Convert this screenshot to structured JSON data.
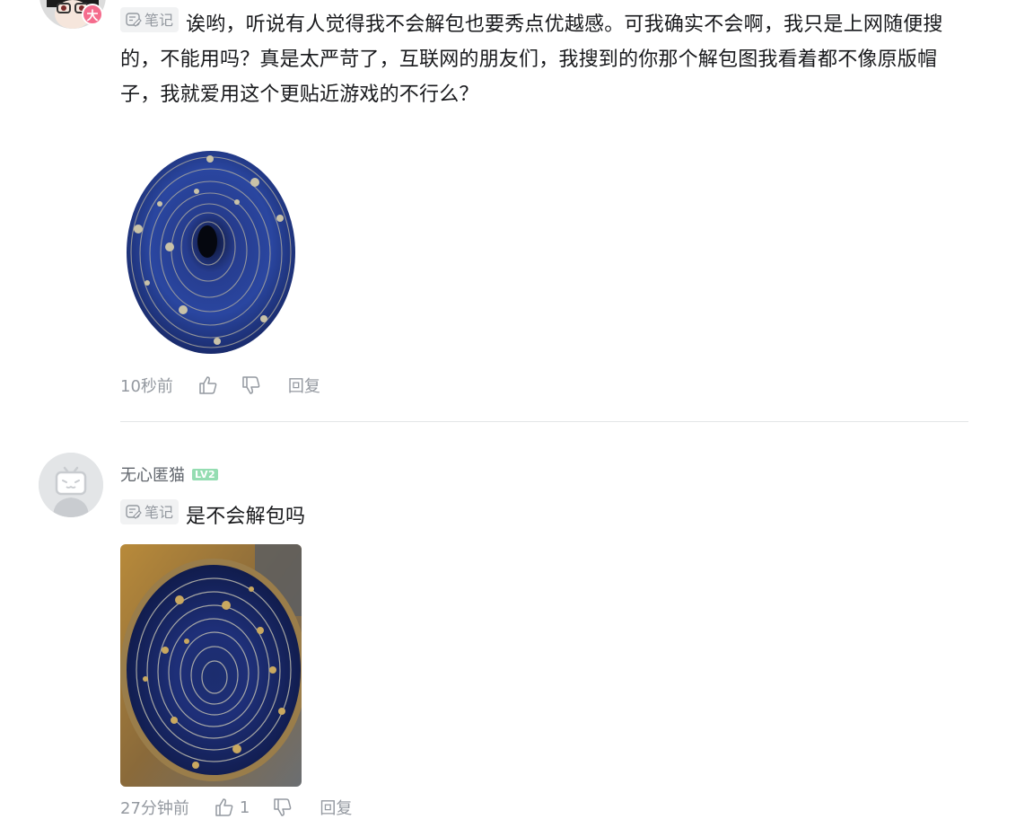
{
  "comments": [
    {
      "note_tag": "笔记",
      "content": "诶哟，听说有人觉得我不会解包也要秀点优越感。可我确实不会啊，我只是上网随便搜的，不能用吗？真是太严苛了，互联网的朋友们，我搜到的你那个解包图我看着都不像原版帽子，我就爱用这个更贴近游戏的不行么？",
      "avatar_badge": "大",
      "time": "10秒前",
      "like_count": "",
      "reply_label": "回复"
    },
    {
      "username": "无心匿猫",
      "level": "LV2",
      "note_tag": "笔记",
      "content": "是不会解包吗",
      "time": "27分钟前",
      "like_count": "1",
      "reply_label": "回复"
    }
  ],
  "icons": {
    "note": "note-icon",
    "like": "thumbs-up-icon",
    "dislike": "thumbs-down-icon",
    "avatar_default": "bilibili-tv-avatar-icon"
  },
  "colors": {
    "text": "#18191c",
    "muted": "#9499a0",
    "tag_bg": "#f1f2f3",
    "badge": "#f56c8d",
    "level": "#95ddb2",
    "hat_blue": "#1d2f7a"
  }
}
